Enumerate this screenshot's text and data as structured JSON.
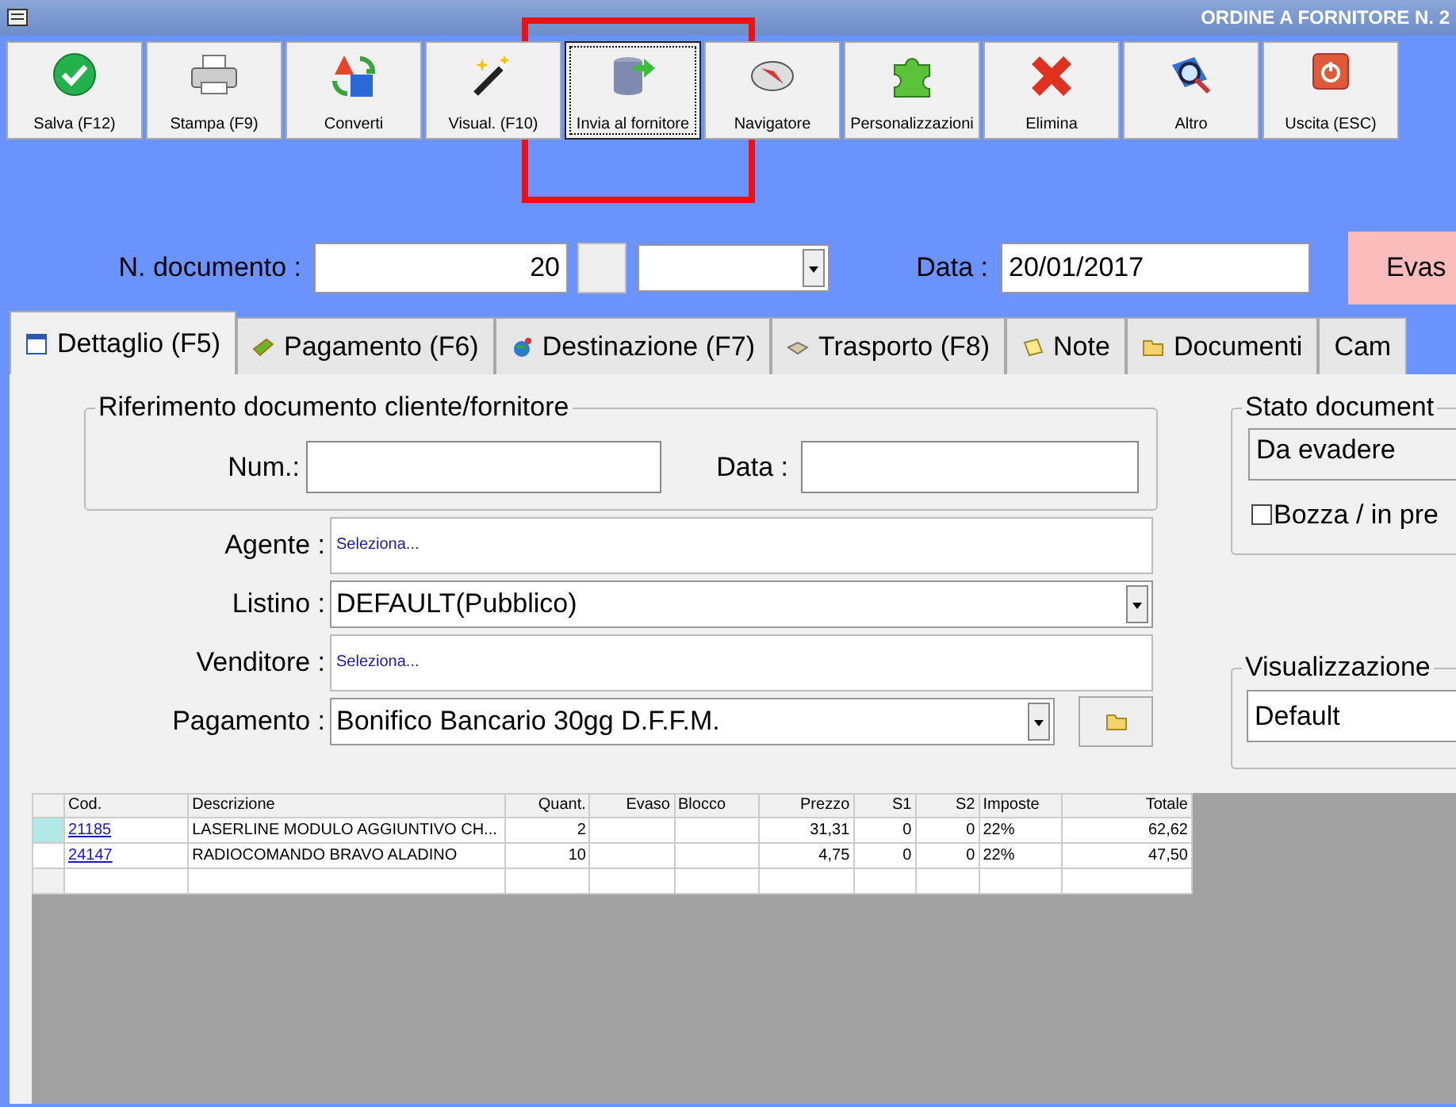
{
  "window": {
    "title": "ORDINE A FORNITORE N. 2"
  },
  "toolbar": [
    {
      "label": "Salva (F12)",
      "selected": false
    },
    {
      "label": "Stampa (F9)",
      "selected": false
    },
    {
      "label": "Converti",
      "selected": false
    },
    {
      "label": "Visual. (F10)",
      "selected": false
    },
    {
      "label": "Invia al fornitore",
      "selected": true
    },
    {
      "label": "Navigatore",
      "selected": false
    },
    {
      "label": "Personalizzazioni",
      "selected": false
    },
    {
      "label": "Elimina",
      "selected": false
    },
    {
      "label": "Altro",
      "selected": false
    },
    {
      "label": "Uscita (ESC)",
      "selected": false
    }
  ],
  "document": {
    "number_label": "N. documento :",
    "number": "20",
    "date_label": "Data :",
    "date": "20/01/2017",
    "status_badge": "Evas"
  },
  "tabs": [
    {
      "label": "Dettaglio (F5)",
      "selected": true
    },
    {
      "label": "Pagamento (F6)",
      "selected": false
    },
    {
      "label": "Destinazione (F7)",
      "selected": false
    },
    {
      "label": "Trasporto (F8)",
      "selected": false
    },
    {
      "label": "Note",
      "selected": false
    },
    {
      "label": "Documenti",
      "selected": false
    },
    {
      "label": "Cam",
      "selected": false
    }
  ],
  "reference": {
    "title": "Riferimento documento cliente/fornitore",
    "num_label": "Num.:",
    "date_label": "Data :"
  },
  "fields": [
    {
      "label": "Agente :",
      "kind": "picker",
      "value": "Seleziona..."
    },
    {
      "label": "Listino :",
      "kind": "dropdown",
      "value": "DEFAULT(Pubblico)"
    },
    {
      "label": "Venditore :",
      "kind": "picker",
      "value": "Seleziona..."
    },
    {
      "label": "Pagamento :",
      "kind": "dropdown_folder",
      "value": "Bonifico Bancario 30gg D.F.F.M."
    }
  ],
  "status_group": {
    "title": "Stato document",
    "value": "Da evadere",
    "draft_label": "Bozza / in pre",
    "draft_checked": false
  },
  "view_group": {
    "title": "Visualizzazione",
    "value": "Default"
  },
  "table": {
    "columns": [
      "Cod.",
      "Descrizione",
      "Quant.",
      "Evaso",
      "Blocco",
      "Prezzo",
      "S1",
      "S2",
      "Imposte",
      "Totale"
    ],
    "rows": [
      {
        "selected": true,
        "cells": [
          "21185",
          "LASERLINE MODULO AGGIUNTIVO CH...",
          "2",
          "",
          "",
          "31,31",
          "0",
          "0",
          "22%",
          "62,62"
        ]
      },
      {
        "selected": false,
        "cells": [
          "24147",
          "RADIOCOMANDO BRAVO ALADINO",
          "10",
          "",
          "",
          "4,75",
          "0",
          "0",
          "22%",
          "47,50"
        ]
      }
    ]
  },
  "annotation": {
    "kind": "highlight_box"
  }
}
